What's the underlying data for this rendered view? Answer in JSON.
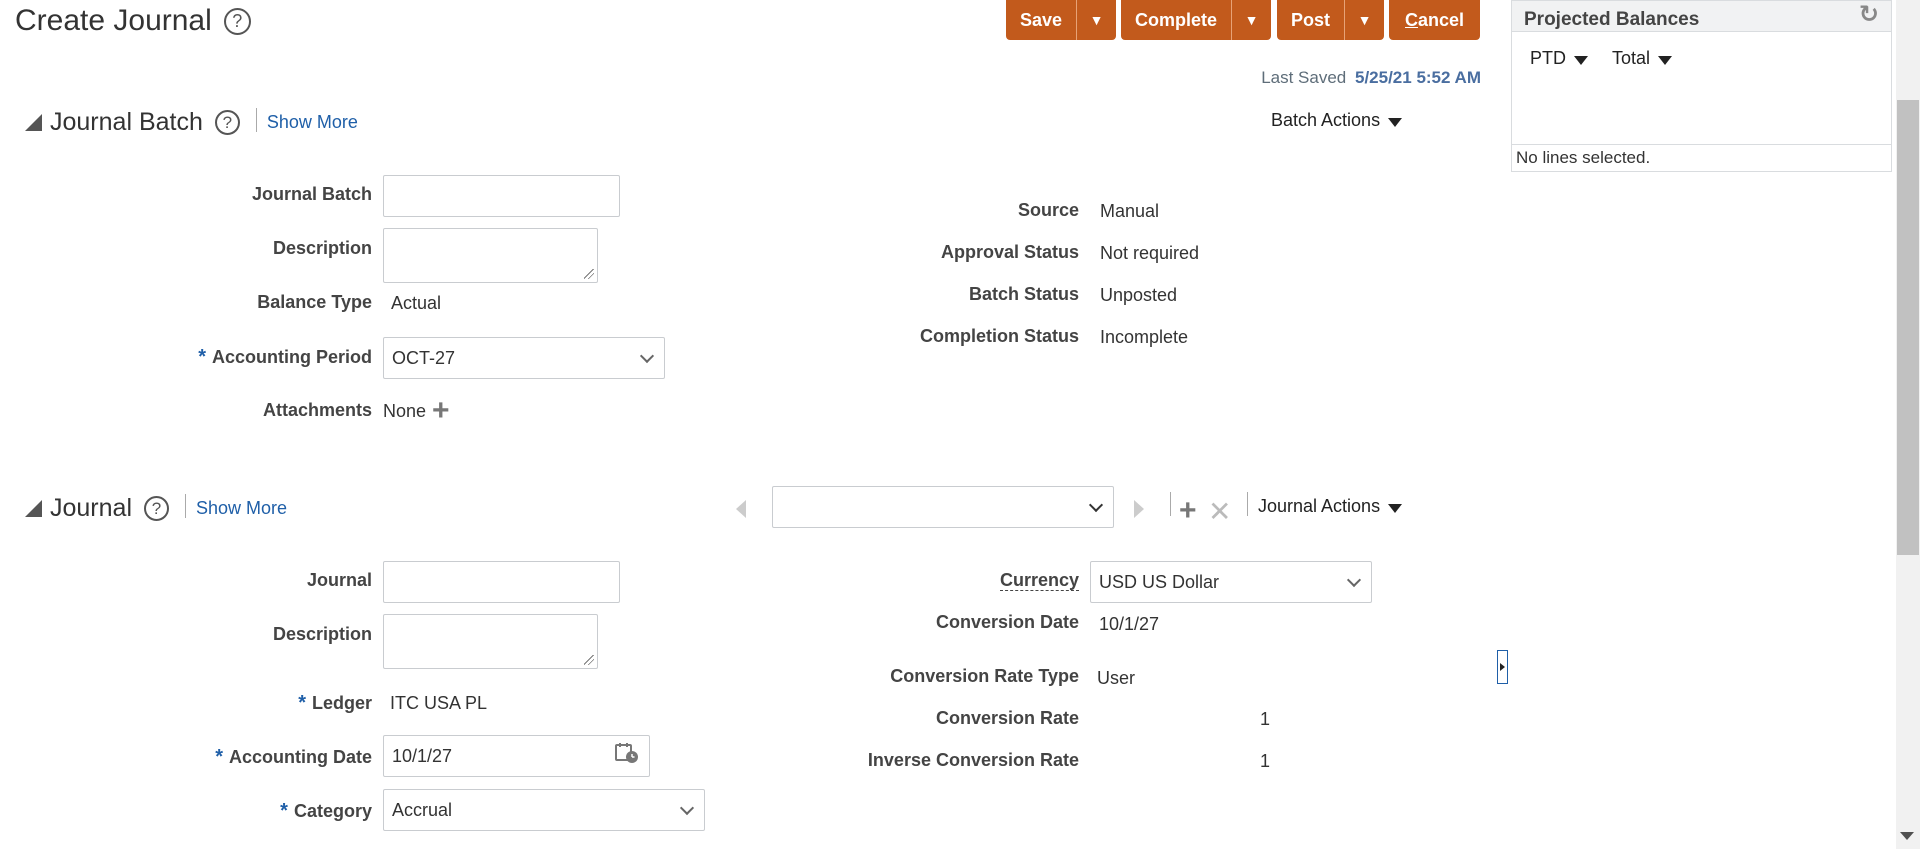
{
  "header": {
    "title": "Create Journal",
    "buttons": {
      "save": "Save",
      "complete": "Complete",
      "post": "Post",
      "cancel_first": "C",
      "cancel_rest": "ancel"
    },
    "last_saved_label": "Last Saved",
    "last_saved_value": "5/25/21 5:52 AM"
  },
  "journal_batch": {
    "heading": "Journal Batch",
    "show_more": "Show More",
    "actions": "Batch Actions",
    "fields": {
      "journal_batch_label": "Journal Batch",
      "journal_batch_value": "",
      "description_label": "Description",
      "description_value": "",
      "balance_type_label": "Balance Type",
      "balance_type_value": "Actual",
      "accounting_period_label": "Accounting Period",
      "accounting_period_value": "OCT-27",
      "attachments_label": "Attachments",
      "attachments_value": "None"
    },
    "status": {
      "source_label": "Source",
      "source_value": "Manual",
      "approval_label": "Approval Status",
      "approval_value": "Not required",
      "batch_label": "Batch Status",
      "batch_value": "Unposted",
      "completion_label": "Completion Status",
      "completion_value": "Incomplete"
    }
  },
  "journal": {
    "heading": "Journal",
    "show_more": "Show More",
    "selector_value": "",
    "actions": "Journal Actions",
    "fields": {
      "journal_label": "Journal",
      "journal_value": "",
      "description_label": "Description",
      "description_value": "",
      "ledger_label": "Ledger",
      "ledger_value": "ITC USA PL",
      "accounting_date_label": "Accounting Date",
      "accounting_date_value": "10/1/27",
      "category_label": "Category",
      "category_value": "Accrual"
    },
    "currency": {
      "currency_label": "Currency",
      "currency_value": "USD US Dollar",
      "conversion_date_label": "Conversion Date",
      "conversion_date_value": "10/1/27",
      "rate_type_label": "Conversion Rate Type",
      "rate_type_value": "User",
      "rate_label": "Conversion Rate",
      "rate_value": "1",
      "inverse_label": "Inverse Conversion Rate",
      "inverse_value": "1"
    }
  },
  "projected_balances": {
    "title": "Projected Balances",
    "ptd": "PTD",
    "total": "Total",
    "footer": "No lines selected."
  },
  "required_mark": "*",
  "help_glyph": "?",
  "icons": [
    "help-icon",
    "dropdown-arrow-icon",
    "collapse-triangle-icon",
    "add-icon",
    "delete-icon",
    "calendar-icon",
    "refresh-icon",
    "chevron-down-icon",
    "prev-arrow-icon",
    "next-arrow-icon",
    "expand-panel-icon"
  ],
  "colors": {
    "accent_button": "#c25a1c",
    "link": "#1f5fa8",
    "required": "#1f5fa8"
  }
}
